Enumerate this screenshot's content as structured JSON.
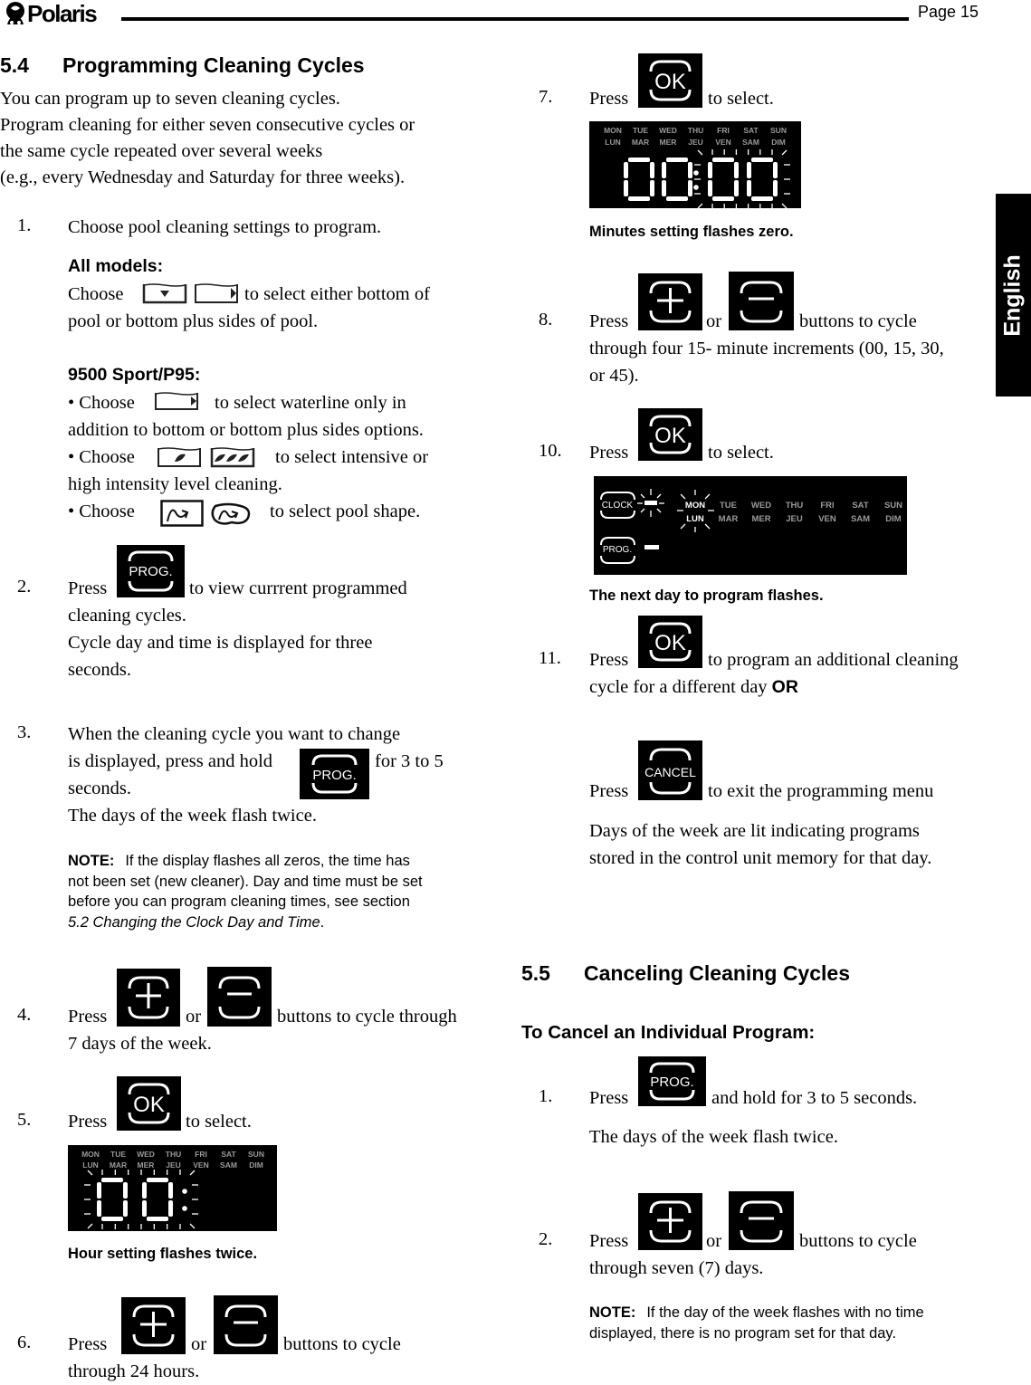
{
  "header": {
    "brand": "Polaris",
    "page_label": "Page 15"
  },
  "language_tab": "English",
  "section_54": {
    "number": "5.4",
    "title": "Programming Cleaning Cycles",
    "intro": [
      "You can program up to seven cleaning cycles.",
      "Program cleaning for either seven consecutive cycles or",
      "the same cycle repeated over several weeks",
      "(e.g., every Wednesday and Saturday for three weeks)."
    ],
    "step1": {
      "num": "1.",
      "text": "Choose pool cleaning settings to program.",
      "all_models_label": "All models:",
      "all_models_choose": "Choose",
      "all_models_text1": "to select either bottom of",
      "all_models_text2": "pool or bottom plus sides of pool.",
      "sport_label": "9500 Sport/P95:",
      "bullet1_choose": "• Choose",
      "bullet1_text1": "to select waterline only in",
      "bullet1_text2": "addition to bottom or bottom plus sides options.",
      "bullet2_choose": "• Choose",
      "bullet2_text1": "to select intensive or",
      "bullet2_text2": "high intensity level cleaning.",
      "bullet3_choose": "• Choose",
      "bullet3_text1": "to select pool shape.",
      "icons": [
        "pool-bottom-icon",
        "pool-bottom-sides-icon",
        "waterline-icon",
        "intensive-clean-icon",
        "high-intensity-clean-icon",
        "rectangular-pool-icon",
        "freeform-pool-icon"
      ]
    },
    "step2": {
      "num": "2.",
      "press": "Press",
      "key": "PROG.",
      "text1": "to view currrent programmed",
      "text2": "cleaning cycles.",
      "text3": "Cycle day and time is displayed for three",
      "text4": "seconds."
    },
    "step3": {
      "num": "3.",
      "text1": "When the cleaning cycle you want to change",
      "text2": "is displayed, press and hold",
      "key": "PROG.",
      "text3": "for 3 to 5",
      "text4": "seconds.",
      "text5": "The days of the week flash twice.",
      "note_label": "NOTE:",
      "note_lines": [
        "If the display flashes all zeros, the time has",
        "not been set (new cleaner). Day and time must be set",
        "before you can program cleaning times, see section"
      ],
      "note_ref": "5.2 Changing the Clock Day and Time",
      "note_end": "."
    },
    "step4": {
      "num": "4.",
      "press": "Press",
      "or": "or",
      "text1": "buttons to cycle through",
      "text2": "7 days of the week."
    },
    "step5": {
      "num": "5.",
      "press": "Press",
      "key": "OK",
      "text1": "to select.",
      "caption": "Hour setting flashes twice."
    },
    "step6": {
      "num": "6.",
      "press": "Press",
      "or": "or",
      "text1": "buttons to cycle",
      "text2": "through 24 hours."
    },
    "step7": {
      "num": "7.",
      "press": "Press",
      "key": "OK",
      "text1": "to select.",
      "caption": "Minutes setting flashes zero."
    },
    "step8": {
      "num": "8.",
      "press": "Press",
      "or": "or",
      "text1": "buttons to cycle",
      "text2": "through four 15- minute increments (00, 15, 30,",
      "text3": "or 45)."
    },
    "step10": {
      "num": "10.",
      "press": "Press",
      "key": "OK",
      "text1": "to select.",
      "caption": "The next day to program flashes."
    },
    "step11": {
      "num": "11.",
      "press": "Press",
      "key": "OK",
      "text1": "to program an additional cleaning",
      "text2": "cycle for a different day",
      "or_word": "OR",
      "press2": "Press",
      "cancel_key": "CANCEL",
      "text3": "to exit the programming menu",
      "text4": "Days of the week are lit indicating programs",
      "text5": "stored in the control unit memory for that day."
    }
  },
  "lcd": {
    "days_en": [
      "MON",
      "TUE",
      "WED",
      "THU",
      "FRI",
      "SAT",
      "SUN"
    ],
    "days_fr": [
      "LUN",
      "MAR",
      "MER",
      "JEU",
      "VEN",
      "SAM",
      "DIM"
    ],
    "hour_digits": "00",
    "time_digits": "00:00",
    "clock_label": "CLOCK",
    "prog_label": "PROG.",
    "flashing_day_en": "MON",
    "flashing_day_fr": "LUN"
  },
  "section_55": {
    "number": "5.5",
    "title": "Canceling Cleaning Cycles",
    "subtitle": "To Cancel an Individual Program:",
    "step1": {
      "num": "1.",
      "press": "Press",
      "key": "PROG.",
      "text1": "and hold for 3 to 5 seconds.",
      "text2": "The days of the week flash twice."
    },
    "step2": {
      "num": "2.",
      "press": "Press",
      "or": "or",
      "text1": "buttons to cycle",
      "text2": "through seven (7) days.",
      "note_label": "NOTE:",
      "note_lines": [
        "If the day of the week flashes with no time",
        "displayed, there is no program set for that day."
      ]
    }
  }
}
